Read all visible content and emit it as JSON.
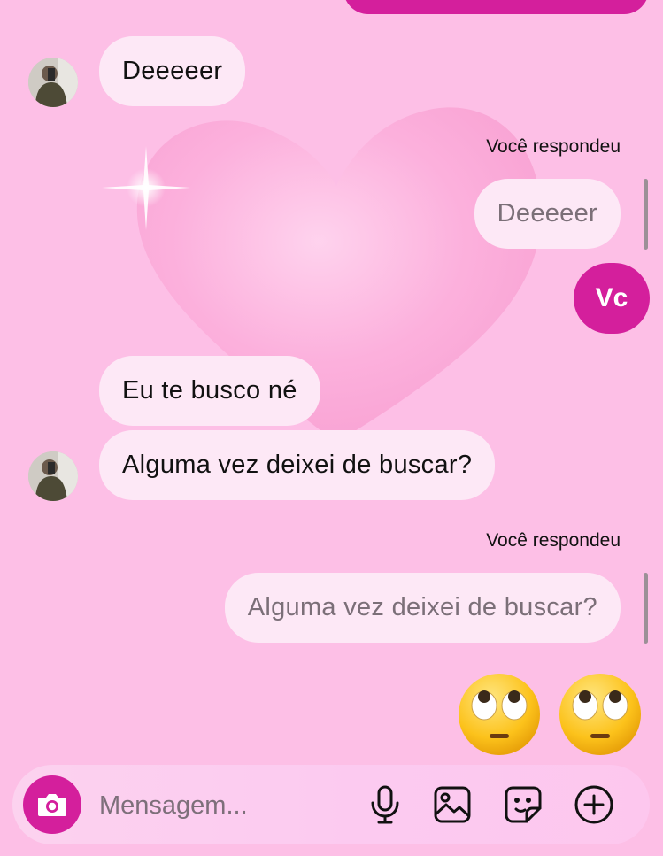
{
  "conversation": {
    "messages": [
      {
        "from": "other",
        "text": "Deeeeer"
      },
      {
        "from": "me",
        "reply_label": "Você respondeu",
        "quoted": "Deeeeer",
        "text": "Vc"
      },
      {
        "from": "other",
        "text": "Eu te busco né"
      },
      {
        "from": "other",
        "text": "Alguma vez deixei de buscar?"
      },
      {
        "from": "me",
        "reply_label": "Você respondeu",
        "quoted": "Alguma vez deixei de buscar?",
        "text": "🙄🙄"
      }
    ]
  },
  "composer": {
    "placeholder": "Mensagem...",
    "icons": [
      "camera-icon",
      "microphone-icon",
      "gallery-icon",
      "sticker-icon",
      "plus-icon"
    ]
  },
  "colors": {
    "background": "#fdbfe6",
    "accent": "#d41f9c",
    "bubble": "#fde8f6"
  }
}
